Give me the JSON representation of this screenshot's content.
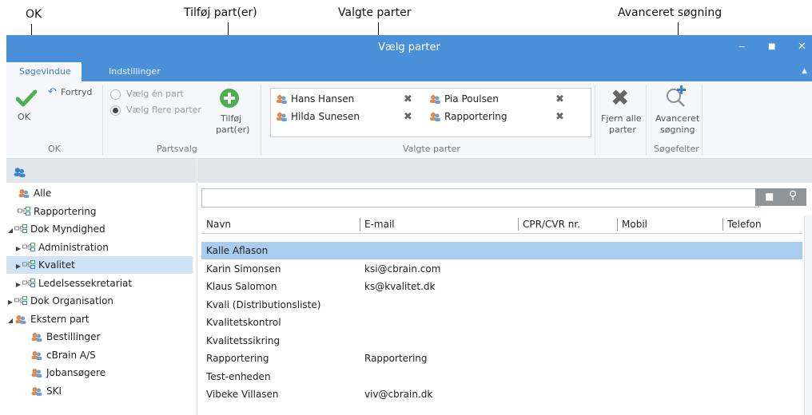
{
  "callouts": {
    "ok": "OK",
    "add_party": "Tilføj part(er)",
    "selected_parties": "Valgte parter",
    "advanced_search": "Avanceret søgning"
  },
  "window": {
    "title": "Vælg parter",
    "controls": {
      "minimize": "‒",
      "maximize": "■",
      "close": "✕"
    }
  },
  "tabs": [
    {
      "label": "Søgevindue",
      "active": true
    },
    {
      "label": "Indstillinger",
      "active": false
    }
  ],
  "ribbon": {
    "ok_label": "OK",
    "undo_label": "Fortryd",
    "group_ok": "OK",
    "radio_single": "Vælg én part",
    "radio_multi": "Vælg flere parter",
    "radio_selected": "multi",
    "group_partsvalg": "Partsvalg",
    "add_label_1": "Tilføj",
    "add_label_2": "part(er)",
    "selected_items": [
      "Hans Hansen",
      "Hilda Sunesen",
      "Pia Poulsen",
      "Rapportering"
    ],
    "group_selected": "Valgte parter",
    "remove_all_1": "Fjern alle",
    "remove_all_2": "parter",
    "advanced_1": "Avanceret",
    "advanced_2": "søgning",
    "group_searchfields": "Søgefelter"
  },
  "nav": {
    "items": [
      {
        "label": "Alle",
        "icon": "persons-icon",
        "expander": "",
        "indent": 0
      },
      {
        "label": "Rapportering",
        "icon": "org-icon",
        "expander": "",
        "indent": 0
      },
      {
        "label": "Dok Myndighed",
        "icon": "org-icon",
        "expander": "expanded",
        "indent": 0
      },
      {
        "label": "Administration",
        "icon": "org-icon",
        "expander": "collapsed",
        "indent": 1
      },
      {
        "label": "Kvalitet",
        "icon": "org-icon",
        "expander": "collapsed",
        "indent": 1,
        "selected": true
      },
      {
        "label": "Ledelsessekretariat",
        "icon": "org-icon",
        "expander": "collapsed",
        "indent": 1
      },
      {
        "label": "Dok Organisation",
        "icon": "org-icon",
        "expander": "collapsed",
        "indent": 0
      },
      {
        "label": "Ekstern part",
        "icon": "persons-icon",
        "expander": "expanded",
        "indent": 0
      },
      {
        "label": "Bestillinger",
        "icon": "persons-icon",
        "expander": "",
        "indent": 1
      },
      {
        "label": "cBrain A/S",
        "icon": "persons-icon",
        "expander": "",
        "indent": 1
      },
      {
        "label": "Jobansøgere",
        "icon": "persons-icon",
        "expander": "",
        "indent": 1
      },
      {
        "label": "SKI",
        "icon": "persons-icon",
        "expander": "",
        "indent": 1
      }
    ]
  },
  "search": {
    "value": "",
    "placeholder": ""
  },
  "table": {
    "columns": [
      "Navn",
      "E-mail",
      "CPR/CVR nr.",
      "Mobil",
      "Telefon"
    ],
    "rows": [
      {
        "name": "Kalle Aflason",
        "email": "",
        "selected": true
      },
      {
        "name": "Karin Simonsen",
        "email": "ksi@cbrain.com"
      },
      {
        "name": "Klaus Salomon",
        "email": "ks@kvalitet.dk"
      },
      {
        "name": "Kvali (Distributionsliste)",
        "email": ""
      },
      {
        "name": "Kvalitetskontrol",
        "email": ""
      },
      {
        "name": "Kvalitetssikring",
        "email": ""
      },
      {
        "name": "Rapportering",
        "email": "Rapportering"
      },
      {
        "name": "Test-enheden",
        "email": ""
      },
      {
        "name": "Vibeke Villasen",
        "email": "viv@cbrain.dk"
      }
    ]
  },
  "colors": {
    "accent": "#4a90d9",
    "selected_row": "#a8cdee",
    "selected_nav": "#cfe3f7",
    "ok_green": "#4caf50"
  }
}
